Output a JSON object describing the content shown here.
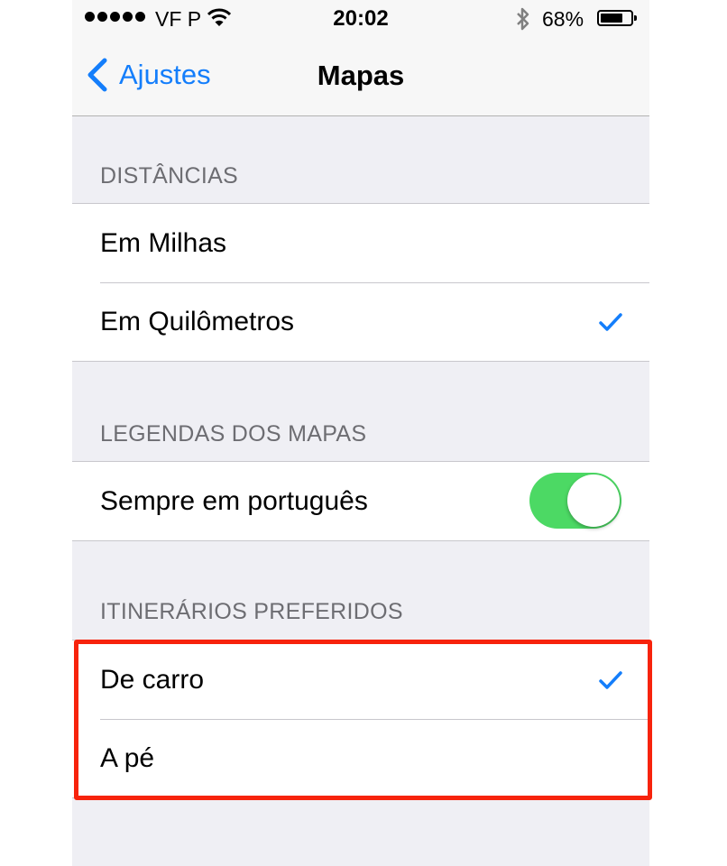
{
  "status_bar": {
    "carrier": "VF P",
    "time": "20:02",
    "battery": "68%"
  },
  "nav": {
    "back_label": "Ajustes",
    "title": "Mapas"
  },
  "sections": [
    {
      "header": "DISTÂNCIAS",
      "rows": [
        {
          "label": "Em Milhas",
          "checked": false
        },
        {
          "label": "Em Quilômetros",
          "checked": true
        }
      ]
    },
    {
      "header": "LEGENDAS DOS MAPAS",
      "rows": [
        {
          "label": "Sempre em português",
          "toggle_on": true
        }
      ]
    },
    {
      "header": "ITINERÁRIOS PREFERIDOS",
      "rows": [
        {
          "label": "De carro",
          "checked": true
        },
        {
          "label": "A pé",
          "checked": false
        }
      ]
    }
  ],
  "colors": {
    "accent": "#147efb",
    "toggle_on": "#4cd964",
    "highlight": "#f7230c"
  }
}
